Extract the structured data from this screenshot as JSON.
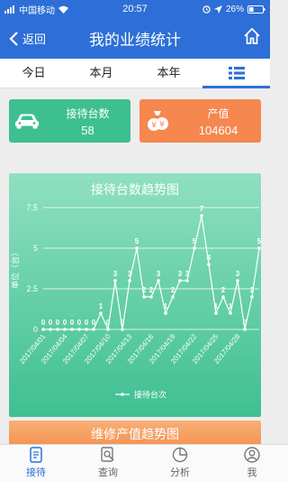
{
  "status_bar": {
    "carrier": "中国移动",
    "time": "20:57",
    "battery": "26%"
  },
  "header": {
    "back_label": "返回",
    "title": "我的业绩统计"
  },
  "tabs": [
    {
      "label": "今日"
    },
    {
      "label": "本月"
    },
    {
      "label": "本年"
    }
  ],
  "summary": {
    "reception": {
      "label": "接待台数",
      "value": "58",
      "color": "#3ebf90"
    },
    "output": {
      "label": "产值",
      "value": "104604",
      "color": "#f5874f"
    }
  },
  "chart_data": {
    "type": "line",
    "title": "接待台数趋势图",
    "ylabel": "单位（台）",
    "yticks": [
      0,
      2.5,
      5,
      7.5
    ],
    "ylim": [
      0,
      7.5
    ],
    "xticks": [
      "2017/04/01",
      "2017/04/04",
      "2017/04/07",
      "2017/04/10",
      "2017/04/13",
      "2017/04/16",
      "2017/04/19",
      "2017/04/22",
      "2017/04/25",
      "2017/04/28"
    ],
    "legend": "top-bottom",
    "series": [
      {
        "name": "接待台次",
        "values": [
          0,
          0,
          0,
          0,
          0,
          0,
          0,
          0,
          1,
          0,
          3,
          0,
          3,
          5,
          2,
          2,
          3,
          1,
          2,
          3,
          3,
          5,
          7,
          4,
          1,
          2,
          1,
          3,
          0,
          2,
          5
        ]
      }
    ]
  },
  "chart2": {
    "title": "维修产值趋势图"
  },
  "bottom_nav": [
    {
      "label": "接待"
    },
    {
      "label": "查询"
    },
    {
      "label": "分析"
    },
    {
      "label": "我"
    }
  ]
}
